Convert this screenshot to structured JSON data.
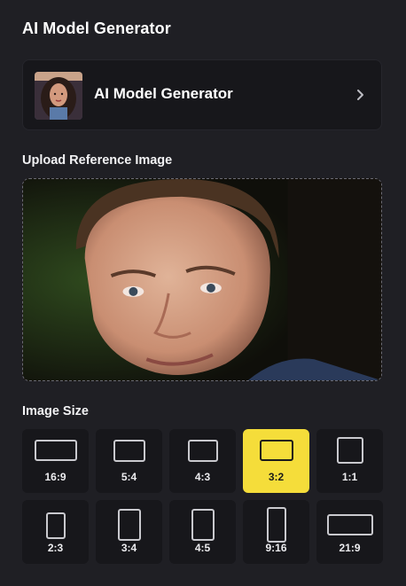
{
  "panel": {
    "title": "AI Model Generator"
  },
  "model_card": {
    "name": "AI Model Generator",
    "thumbnail_icon": "model-portrait-thumbnail",
    "chevron_icon": "chevron-right-icon"
  },
  "upload": {
    "label": "Upload Reference Image"
  },
  "image_size": {
    "label": "Image Size",
    "selected": "3:2",
    "options": [
      "16:9",
      "5:4",
      "4:3",
      "3:2",
      "1:1",
      "2:3",
      "3:4",
      "4:5",
      "9:16",
      "21:9"
    ]
  },
  "colors": {
    "background": "#1f1f24",
    "card": "#17171b",
    "accent": "#f5dd3a"
  }
}
